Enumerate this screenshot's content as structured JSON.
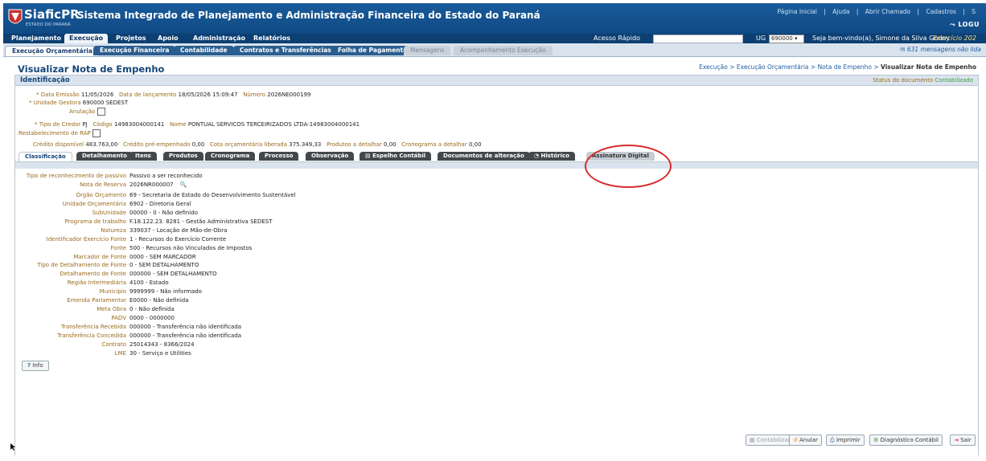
{
  "header": {
    "app_name": "SiaficPR",
    "app_subtitle": "ESTADO DO PARANÁ",
    "system_title": "Sistema Integrado de Planejamento e Administração Financeira do Estado do Paraná",
    "links": [
      "Página Inicial",
      "|",
      "Ajuda",
      "|",
      "Abrir Chamado",
      "|",
      "Cadastros",
      "|",
      "S"
    ],
    "brand": "LOGU"
  },
  "menu": {
    "items": [
      "Planejamento",
      "Execução",
      "Projetos",
      "Apoio",
      "Administração",
      "Relatórios"
    ],
    "active": "Execução",
    "quick_access_label": "Acesso Rápido",
    "ug_label": "UG",
    "ug_value": "690000",
    "welcome": "Seja bem-vindo(a), Simone da Silva Godoy",
    "exercise": "Exercício 202"
  },
  "subtabs": {
    "items": [
      "Execução Orçamentária",
      "Execução Financeira",
      "Contabilidade",
      "Contratos e Transferências",
      "Folha de Pagamento",
      "Mensagens",
      "Acompanhamento Execução"
    ],
    "messages": "631 mensagens não lida"
  },
  "page": {
    "title": "Visualizar Nota de Empenho",
    "breadcrumb": "Execução > Execução Orçamentária > Nota de Empenho > ",
    "breadcrumb_current": "Visualizar Nota de Empenho"
  },
  "identificacao": {
    "title": "Identificação",
    "status_label": "Status do documento",
    "status_value": "Contabilizado",
    "data_emissao_label": "* Data Emissão",
    "data_emissao": "11/05/2026",
    "data_lancamento_label": "Data de lançamento",
    "data_lancamento": "18/05/2026 15:09:47",
    "numero_label": "Número",
    "numero": "2026NE000199",
    "unidade_gestora_label": "* Unidade Gestora",
    "unidade_gestora": "690000 SEDEST",
    "anulacao_label": "Anulação",
    "tipo_credor_label": "* Tipo de Credor",
    "tipo_credor": "PJ",
    "codigo_label": "Código",
    "codigo": "14983004000141",
    "nome_label": "Nome",
    "nome": "PONTUAL SERVICOS TERCEIRIZADOS LTDA-14983004000141",
    "restabelecimento_label": "Restabelecimento de RAP",
    "credito_disponivel_label": "Crédito disponível",
    "credito_disponivel": "483.763,00",
    "credito_pre_label": "Crédito pré-empenhado",
    "credito_pre": "0,00",
    "cota_label": "Cota orçamentária liberada",
    "cota": "375.349,33",
    "produtos_label": "Produtos a detalhar",
    "produtos": "0,00",
    "cronograma_label": "Cronograma a detalhar",
    "cronograma": "0,00"
  },
  "detail_tabs": [
    "Classificação",
    "Detalhamento",
    "Itens",
    "Produtos",
    "Cronograma",
    "Processo",
    "Observação",
    "Espelho Contábil",
    "Documentos de alteração",
    "Histórico",
    "Assinatura Digital"
  ],
  "classificacao": [
    {
      "label": "Tipo de reconhecimento de passivo",
      "value": "Passivo a ser reconhecido"
    },
    {
      "label": "Nota de Reserva",
      "value": "2026NR000007"
    },
    {
      "label": "Órgão Orçamento",
      "value": "69 - Secretaria de Estado do Desenvolvimento Sustentável"
    },
    {
      "label": "Unidade Orçamentária",
      "value": "6902 - Diretoria Geral"
    },
    {
      "label": "SubUnidade",
      "value": "00000 - 0 - Não definido"
    },
    {
      "label": "Programa de trabalho",
      "value": "F.18.122.23. 8281 - Gestão Administrativa SEDEST"
    },
    {
      "label": "Natureza",
      "value": "339037 - Locação de Mão-de-Obra"
    },
    {
      "label": "Identificador Exercício Fonte",
      "value": "1 - Recursos do Exercício Corrente"
    },
    {
      "label": "Fonte",
      "value": "500 - Recursos não Vinculados de Impostos"
    },
    {
      "label": "Marcador de Fonte",
      "value": "0000 - SEM MARCADOR"
    },
    {
      "label": "Tipo de Detalhamento de Fonte",
      "value": "0 - SEM DETALHAMENTO"
    },
    {
      "label": "Detalhamento de Fonte",
      "value": "000000 - SEM DETALHAMENTO"
    },
    {
      "label": "Região Intermediária",
      "value": "4100 - Estado"
    },
    {
      "label": "Município",
      "value": "9999999 - Não informado"
    },
    {
      "label": "Emenda Parlamentar",
      "value": "E0000 - Não definida"
    },
    {
      "label": "Meta Obra",
      "value": "0 - Não definida"
    },
    {
      "label": "PADV",
      "value": "0000 - 0000000"
    },
    {
      "label": "Transferência Recebida",
      "value": "000000 - Transferência não identificada"
    },
    {
      "label": "Transferência Concedida",
      "value": "000000 - Transferência não identificada"
    },
    {
      "label": "Contrato",
      "value": "25014343 - 8366/2024"
    },
    {
      "label": "LME",
      "value": "30 - Serviço e Utilities"
    }
  ],
  "info_button": "Info",
  "actions": [
    "Contabilizar",
    "Anular",
    "Imprimir",
    "Diagnóstico Contábil",
    "Sair"
  ]
}
